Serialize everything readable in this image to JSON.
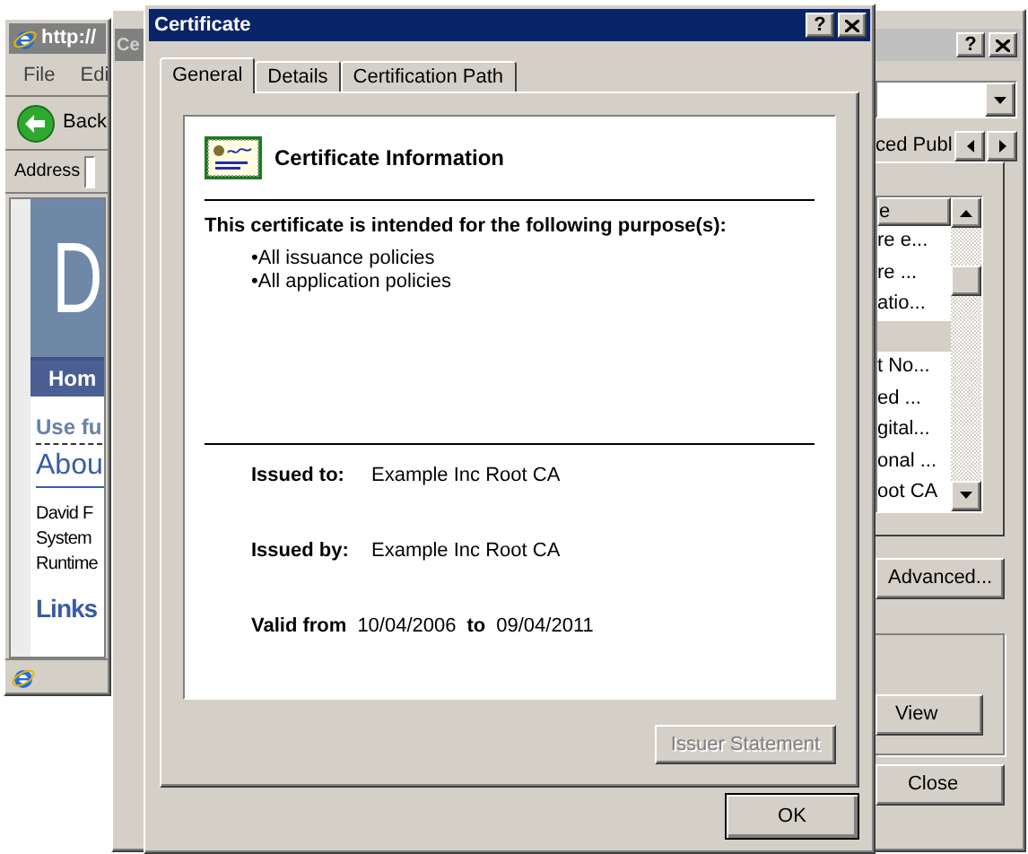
{
  "browser_window": {
    "title": "http://",
    "menu": [
      "File",
      "Edi"
    ],
    "back": "Back",
    "address_label": "Address",
    "page": {
      "banner": "D",
      "nav": "Hom",
      "tagline": "Use fu",
      "heading_1": "Abou",
      "lines": [
        "David F",
        "System",
        "Runtime"
      ],
      "heading_2": "Links"
    }
  },
  "certificates_window": {
    "title": "Ce",
    "help": "?",
    "tab": "ced Publ",
    "list": {
      "column": "e",
      "rows": [
        {
          "text": "re e...",
          "selected": false
        },
        {
          "text": "re ...",
          "selected": false
        },
        {
          "text": "atio...",
          "selected": false
        },
        {
          "selected": true
        },
        {
          "text": "t No...",
          "selected": false
        },
        {
          "text": "ed ...",
          "selected": false
        },
        {
          "text": "gital...",
          "selected": false
        },
        {
          "text": "onal ...",
          "selected": false
        },
        {
          "text": "oot CA",
          "selected": false
        }
      ]
    },
    "advanced": "Advanced...",
    "view": "View",
    "close": "Close"
  },
  "certificate_dialog": {
    "title": "Certificate",
    "help": "?",
    "tabs": [
      {
        "label": "General",
        "selected": true
      },
      {
        "label": "Details",
        "selected": false
      },
      {
        "label": "Certification Path",
        "selected": false
      }
    ],
    "heading": "Certificate Information",
    "purpose_intro": "This certificate is intended for the following purpose(s):",
    "purposes": [
      "•All issuance policies",
      "•All application policies"
    ],
    "issued_to": {
      "label": "Issued to:",
      "value": "Example Inc Root CA"
    },
    "issued_by": {
      "label": "Issued by:",
      "value": "Example Inc Root CA"
    },
    "validity": {
      "from_label": "Valid from",
      "from": "10/04/2006",
      "to_label": "to",
      "to": "09/04/2011"
    },
    "issuer_statement": {
      "label": "Issuer Statement",
      "disabled": true
    },
    "ok": "OK"
  }
}
